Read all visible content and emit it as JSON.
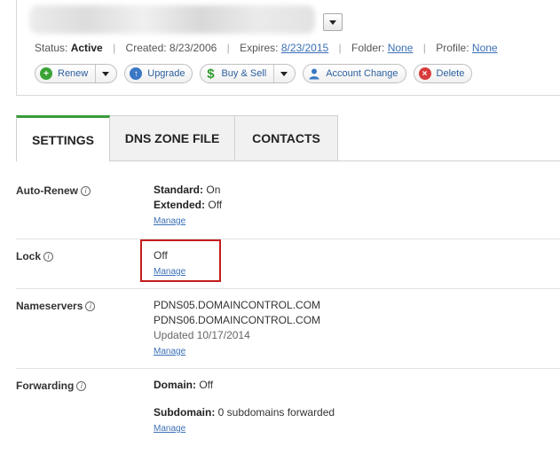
{
  "domain_header": {
    "meta": {
      "status_label": "Status:",
      "status_value": "Active",
      "created_label": "Created: 8/23/2006",
      "expires_label": "Expires:",
      "expires_value": "8/23/2015",
      "folder_label": "Folder:",
      "folder_value": "None",
      "profile_label": "Profile:",
      "profile_value": "None"
    },
    "actions": [
      {
        "label": "Renew",
        "icon": "plus-circle-icon"
      },
      {
        "label": "Upgrade",
        "icon": "arrow-up-circle-icon"
      },
      {
        "label": "Buy & Sell",
        "icon": "dollar-icon"
      },
      {
        "label": "Account Change",
        "icon": "user-icon"
      },
      {
        "label": "Delete",
        "icon": "delete-circle-icon"
      }
    ]
  },
  "tabs": [
    {
      "label": "SETTINGS",
      "active": true
    },
    {
      "label": "DNS ZONE FILE",
      "active": false
    },
    {
      "label": "CONTACTS",
      "active": false
    }
  ],
  "settings": {
    "auto_renew": {
      "label": "Auto-Renew",
      "standard_label": "Standard:",
      "standard_value": "On",
      "extended_label": "Extended:",
      "extended_value": "Off",
      "manage": "Manage"
    },
    "lock": {
      "label": "Lock",
      "value": "Off",
      "manage": "Manage"
    },
    "nameservers": {
      "label": "Nameservers",
      "ns1": "PDNS05.DOMAINCONTROL.COM",
      "ns2": "PDNS06.DOMAINCONTROL.COM",
      "updated": "Updated 10/17/2014",
      "manage": "Manage"
    },
    "forwarding": {
      "label": "Forwarding",
      "domain_label": "Domain:",
      "domain_value": "Off",
      "subdomain_label": "Subdomain:",
      "subdomain_value": "0 subdomains forwarded",
      "manage": "Manage"
    }
  },
  "colors": {
    "tab_active_accent": "#3a9a3a",
    "link": "#3b6fb6",
    "highlight_box": "#c51c1c"
  }
}
